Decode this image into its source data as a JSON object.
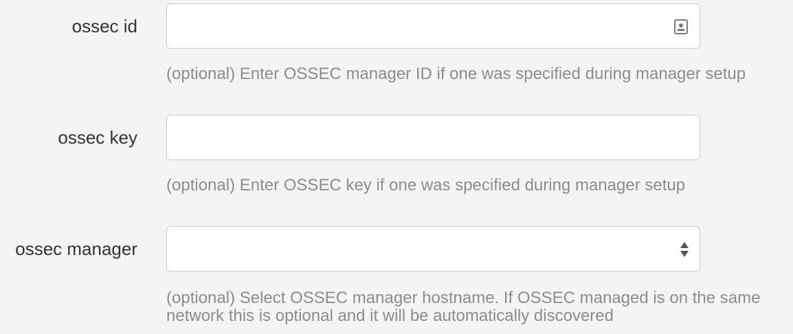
{
  "fields": {
    "ossec_id": {
      "label": "ossec id",
      "value": "",
      "help": "(optional) Enter OSSEC manager ID if one was specified during manager setup"
    },
    "ossec_key": {
      "label": "ossec key",
      "value": "",
      "help": "(optional) Enter OSSEC key if one was specified during manager setup"
    },
    "ossec_manager": {
      "label": "ossec manager",
      "selected": "",
      "help": "(optional) Select OSSEC manager hostname. If OSSEC managed is on the same network this is optional and it will be automatically discovered"
    }
  },
  "colors": {
    "background": "#f4f4f4",
    "label": "#333333",
    "help": "#8c8c8c",
    "border": "#cccccc",
    "input_bg": "#ffffff"
  },
  "icons": {
    "ossec_id_autofill": "contact-card-icon",
    "ossec_manager_select": "select-arrows-icon"
  }
}
